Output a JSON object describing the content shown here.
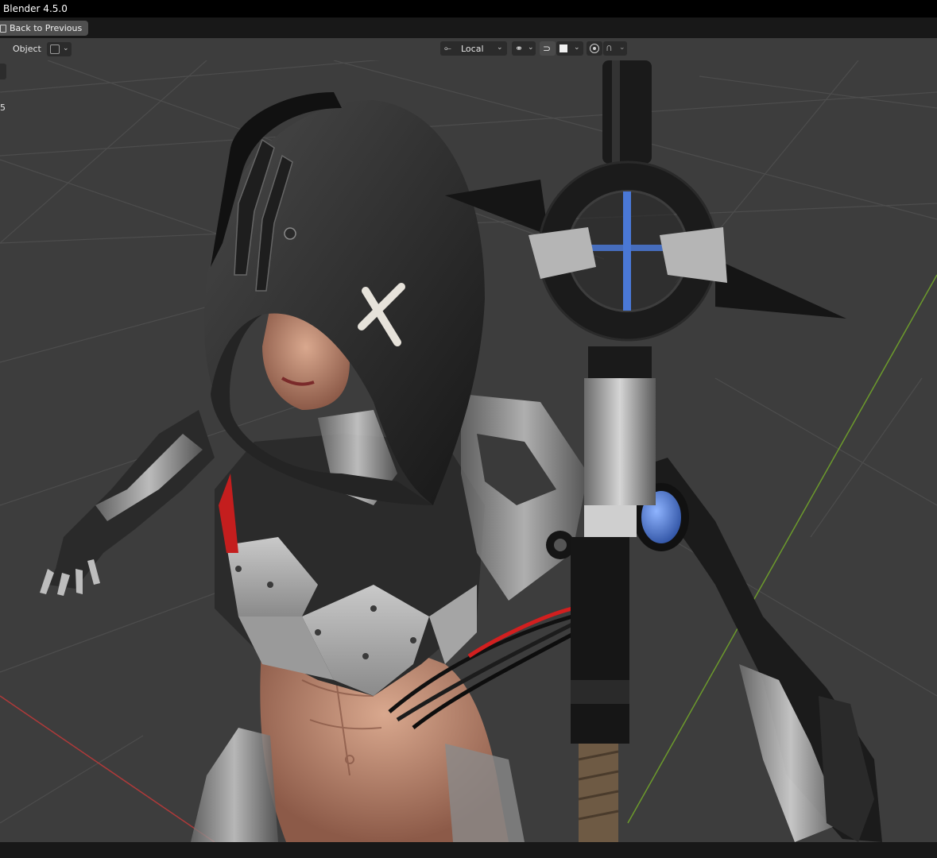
{
  "window": {
    "title": "Blender 4.5.0"
  },
  "topbar": {
    "back_label": "Back to Previous"
  },
  "header": {
    "mode_label": "Object",
    "transform_orientation": "Local",
    "icons": [
      "object-mode-icon",
      "transform-orientation-icon",
      "pivot-icon",
      "snap-icon",
      "snap-target-icon",
      "proportional-edit-icon",
      "falloff-icon"
    ]
  },
  "viewport": {
    "overlay_text": "5",
    "axis_colors": {
      "x": "#b03a3a",
      "y": "#6c9a2c"
    },
    "accent_blue": "#4a78d6"
  }
}
